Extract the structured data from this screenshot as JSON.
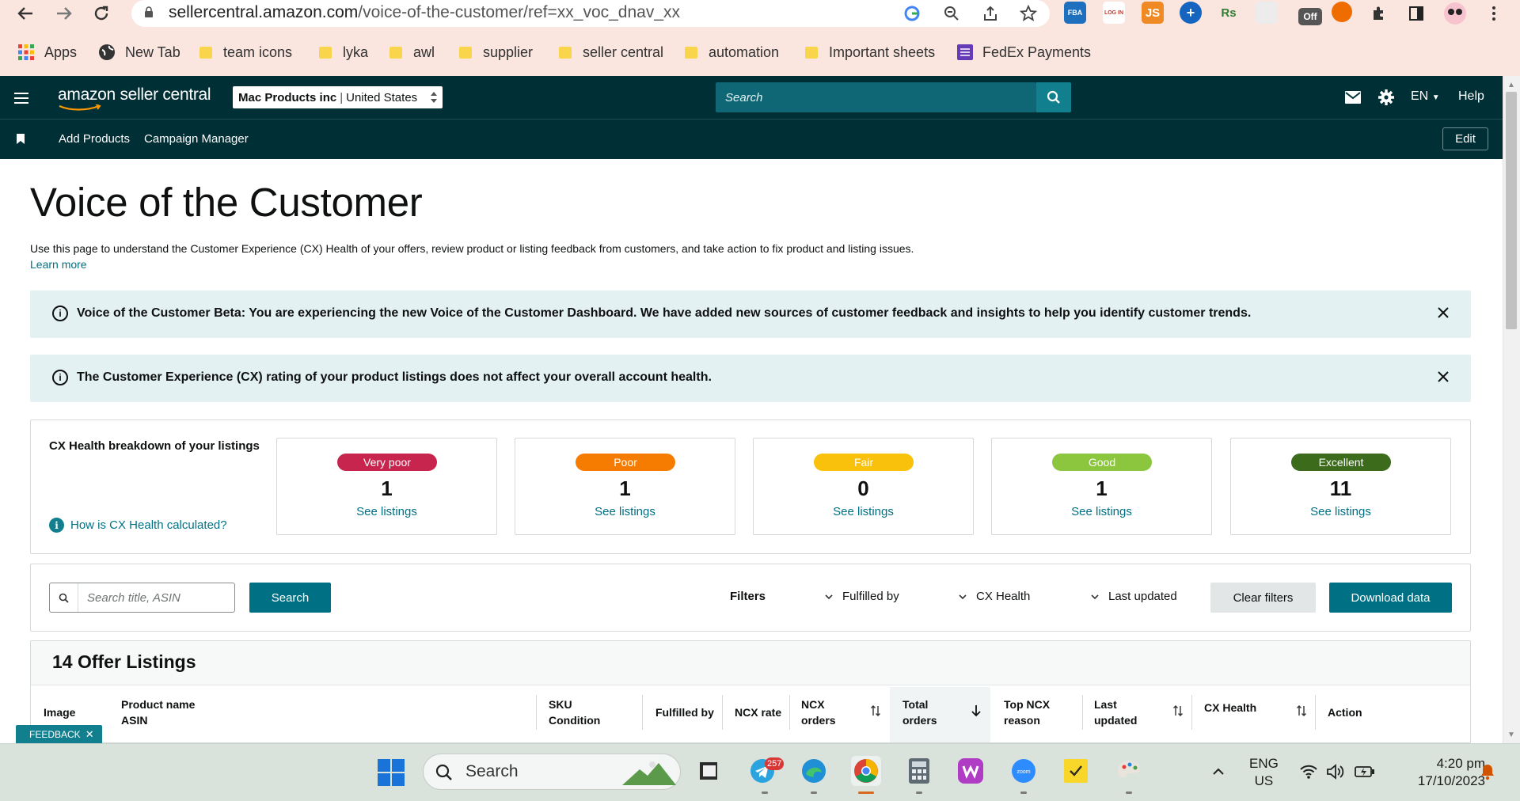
{
  "browser": {
    "url_domain": "sellercentral.amazon.com",
    "url_path": "/voice-of-the-customer/ref=xx_voc_dnav_xx",
    "extensions": [
      {
        "name": "fba-extension",
        "label": "FBA",
        "color": "#1f6fbf"
      },
      {
        "name": "login-extension",
        "label": "LOG IN",
        "color": "#c0392b"
      },
      {
        "name": "js-extension",
        "label": "JS",
        "color": "#f08a24"
      },
      {
        "name": "plus-extension",
        "label": "+",
        "color": "#1565c0"
      },
      {
        "name": "rs-extension",
        "label": "Rs",
        "color": "#2e7d32"
      },
      {
        "name": "edit-extension",
        "label": "",
        "color": "#e0e0e0"
      },
      {
        "name": "off-extension",
        "label": "Off",
        "color": "#555555"
      },
      {
        "name": "circle-extension",
        "label": "",
        "color": "#ef6c00"
      }
    ],
    "bookmarks": [
      {
        "name": "bookmark-apps",
        "label": "Apps"
      },
      {
        "name": "bookmark-new-tab",
        "label": "New Tab"
      },
      {
        "name": "bookmark-team-icons",
        "label": "team icons"
      },
      {
        "name": "bookmark-lyka",
        "label": "lyka"
      },
      {
        "name": "bookmark-awl",
        "label": "awl"
      },
      {
        "name": "bookmark-supplier",
        "label": "supplier"
      },
      {
        "name": "bookmark-seller-central",
        "label": "seller central"
      },
      {
        "name": "bookmark-automation",
        "label": "automation"
      },
      {
        "name": "bookmark-important-sheets",
        "label": "Important sheets"
      },
      {
        "name": "bookmark-fedex-payments",
        "label": "FedEx Payments"
      }
    ]
  },
  "header": {
    "logo_text": "amazon seller central",
    "account_name": "Mac Products inc",
    "account_region": "United States",
    "search_placeholder": "Search",
    "language": "EN",
    "help": "Help"
  },
  "subnav": {
    "links": [
      "Add Products",
      "Campaign Manager"
    ],
    "edit": "Edit"
  },
  "page": {
    "title": "Voice of the Customer",
    "description": "Use this page to understand the Customer Experience (CX) Health of your offers, review product or listing feedback from customers, and take action to fix product and listing issues.",
    "learn_more": "Learn more",
    "alerts": [
      "Voice of the Customer Beta: You are experiencing the new Voice of the Customer Dashboard. We have added new sources of customer feedback and insights to help you identify customer trends.",
      "The Customer Experience (CX) rating of your product listings does not affect your overall account health."
    ]
  },
  "cx_health": {
    "title": "CX Health breakdown of your listings",
    "how_link": "How is CX Health calculated?",
    "see_listings": "See listings",
    "categories": [
      {
        "label": "Very poor",
        "count": "1",
        "color": "#c7254e"
      },
      {
        "label": "Poor",
        "count": "1",
        "color": "#f57c00"
      },
      {
        "label": "Fair",
        "count": "0",
        "color": "#f9c00c"
      },
      {
        "label": "Good",
        "count": "1",
        "color": "#8cc63f"
      },
      {
        "label": "Excellent",
        "count": "11",
        "color": "#3b6b1b"
      }
    ]
  },
  "filters": {
    "search_placeholder": "Search title, ASIN",
    "search_button": "Search",
    "filters_label": "Filters",
    "dropdowns": [
      "Fulfilled by",
      "CX Health",
      "Last updated"
    ],
    "clear": "Clear filters",
    "download": "Download data"
  },
  "listings": {
    "title": "14 Offer Listings",
    "columns": {
      "image": "Image",
      "product_name": "Product name",
      "asin": "ASIN",
      "sku": "SKU",
      "condition": "Condition",
      "fulfilled_by": "Fulfilled by",
      "ncx_rate": "NCX rate",
      "ncx": "NCX",
      "orders": "orders",
      "total": "Total",
      "top_ncx": "Top NCX",
      "reason": "reason",
      "last": "Last",
      "updated": "updated",
      "cx_health": "CX Health",
      "action": "Action"
    }
  },
  "feedback_tab": "FEEDBACK",
  "taskbar": {
    "search_text": "Search",
    "telegram_badge": "257",
    "lang_line1": "ENG",
    "lang_line2": "US",
    "time": "4:20 pm",
    "date": "17/10/2023"
  }
}
